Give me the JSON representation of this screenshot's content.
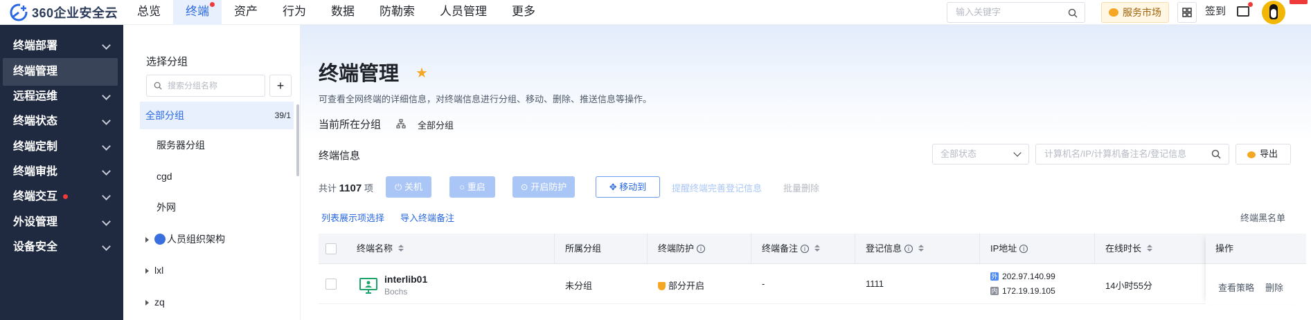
{
  "brand": {
    "name": "360企业安全云"
  },
  "nav": {
    "items": [
      {
        "label": "总览"
      },
      {
        "label": "终端"
      },
      {
        "label": "资产"
      },
      {
        "label": "行为"
      },
      {
        "label": "数据"
      },
      {
        "label": "防勒索"
      },
      {
        "label": "人员管理"
      },
      {
        "label": "更多"
      }
    ],
    "active_index": 1
  },
  "topbar": {
    "search_placeholder": "输入关键字",
    "service_market": "服务市场",
    "signin": "签到"
  },
  "sidebar": {
    "items": [
      {
        "label": "终端部署"
      },
      {
        "label": "终端管理"
      },
      {
        "label": "远程运维"
      },
      {
        "label": "终端状态"
      },
      {
        "label": "终端定制"
      },
      {
        "label": "终端审批"
      },
      {
        "label": "终端交互"
      },
      {
        "label": "外设管理"
      },
      {
        "label": "设备安全"
      }
    ],
    "active_index": 1
  },
  "groups": {
    "title": "选择分组",
    "search_placeholder": "搜索分组名称",
    "all": {
      "label": "全部分组",
      "count": "39/1"
    },
    "items": [
      {
        "label": "服务器分组"
      },
      {
        "label": "cgd"
      },
      {
        "label": "外网"
      },
      {
        "label": "人员组织架构"
      },
      {
        "label": "lxl"
      },
      {
        "label": "zq"
      }
    ]
  },
  "page": {
    "title": "终端管理",
    "description": "可查看全网终端的详细信息，对终端信息进行分组、移动、删除、推送信息等操作。",
    "current_group_label": "当前所在分组",
    "current_group_value": "全部分组",
    "info_label": "终端信息",
    "status_filter": "全部状态",
    "search_placeholder": "计算机名/IP/计算机备注名/登记信息",
    "export": "导出"
  },
  "actions": {
    "total_prefix": "共计",
    "total_count": "1107",
    "total_suffix": "项",
    "shutdown": "关机",
    "restart": "重启",
    "enable_protect": "开启防护",
    "move_to": "移动到",
    "remind_register": "提醒终端完善登记信息",
    "batch_delete": "批量删除",
    "list_display": "列表展示项选择",
    "import_notes": "导入终端备注",
    "blacklist": "终端黑名单"
  },
  "table": {
    "columns": [
      "终端名称",
      "所属分组",
      "终端防护",
      "终端备注",
      "登记信息",
      "IP地址",
      "在线时长",
      "操作"
    ],
    "rows": [
      {
        "name": "interlib01",
        "sub": "Bochs",
        "group": "未分组",
        "protection": "部分开启",
        "note": "-",
        "register": "1111",
        "ip_ext_tag": "外",
        "ip_ext": "202.97.140.99",
        "ip_int_tag": "内",
        "ip_int": "172.19.19.105",
        "online": "14小时55分",
        "op_view": "查看策略",
        "op_delete": "删除"
      }
    ]
  },
  "colors": {
    "accent": "#2968e0",
    "sidebar_bg": "#1f2940",
    "warning": "#f5a623",
    "alert_dot": "#ef3a3a"
  }
}
